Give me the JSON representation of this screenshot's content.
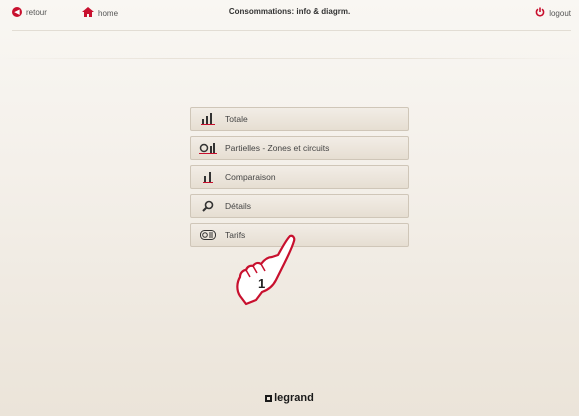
{
  "nav": {
    "retour_label": "retour",
    "home_label": "home",
    "logout_label": "logout",
    "title": "Consommations: info & diagrm."
  },
  "menu": {
    "items": [
      {
        "label": "Totale",
        "icon": "bar-chart-icon"
      },
      {
        "label": "Partielles - Zones et circuits",
        "icon": "zones-chart-icon"
      },
      {
        "label": "Comparaison",
        "icon": "comparison-chart-icon"
      },
      {
        "label": "Détails",
        "icon": "magnifier-icon"
      },
      {
        "label": "Tarifs",
        "icon": "tariff-icon"
      }
    ]
  },
  "annotation": {
    "step": "1"
  },
  "brand": {
    "name": "legrand"
  },
  "colors": {
    "accent": "#c8102e",
    "menu_border": "#cfc6b8",
    "background": "#f4f0ea"
  }
}
